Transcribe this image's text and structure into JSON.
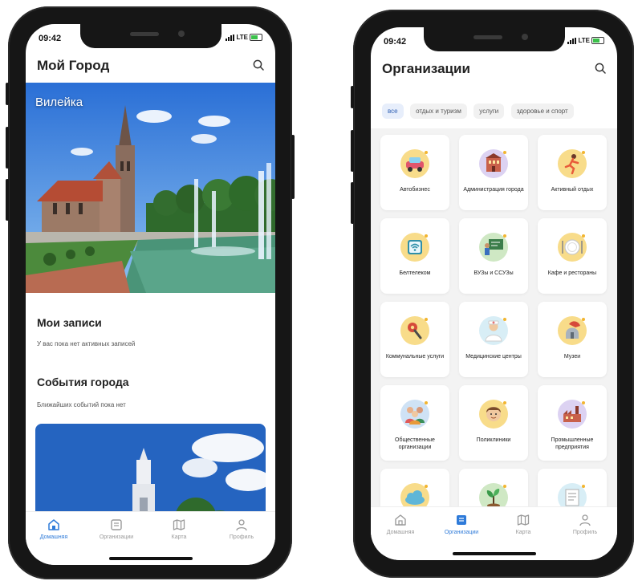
{
  "status": {
    "time": "09:42",
    "network": "LTE"
  },
  "left_screen": {
    "title": "Мой Город",
    "hero_city": "Вилейка",
    "my_records": {
      "title": "Мои записи",
      "text": "У вас пока нет активных записей"
    },
    "events": {
      "title": "События города",
      "text": "Ближайших событий пока нет"
    },
    "tabs": [
      {
        "label": "Домашняя",
        "active": true
      },
      {
        "label": "Организации",
        "active": false
      },
      {
        "label": "Карта",
        "active": false
      },
      {
        "label": "Профиль",
        "active": false
      }
    ]
  },
  "right_screen": {
    "title": "Организации",
    "chips": [
      {
        "label": "все",
        "active": true
      },
      {
        "label": "отдых и туризм",
        "active": false
      },
      {
        "label": "услуги",
        "active": false
      },
      {
        "label": "здоровье и спорт",
        "active": false
      }
    ],
    "categories": [
      {
        "label": "Автобизнес",
        "icon": "car-icon"
      },
      {
        "label": "Администрация города",
        "icon": "building-icon"
      },
      {
        "label": "Активный отдых",
        "icon": "runner-icon"
      },
      {
        "label": "Белтелеком",
        "icon": "wifi-icon"
      },
      {
        "label": "ВУЗы и ССУЗы",
        "icon": "teacher-icon"
      },
      {
        "label": "Кафе и рестораны",
        "icon": "plate-icon"
      },
      {
        "label": "Коммунальные услуги",
        "icon": "wrench-icon"
      },
      {
        "label": "Медицинские центры",
        "icon": "doctor-icon"
      },
      {
        "label": "Музеи",
        "icon": "helmet-icon"
      },
      {
        "label": "Общественные организации",
        "icon": "people-icon"
      },
      {
        "label": "Поликлиники",
        "icon": "patient-icon"
      },
      {
        "label": "Промышленные предприятия",
        "icon": "factory-icon"
      },
      {
        "label": "",
        "icon": "cloud-icon"
      },
      {
        "label": "",
        "icon": "sprout-icon"
      },
      {
        "label": "",
        "icon": "document-icon"
      }
    ],
    "tabs": [
      {
        "label": "Домашняя",
        "active": false
      },
      {
        "label": "Организации",
        "active": true
      },
      {
        "label": "Карта",
        "active": false
      },
      {
        "label": "Профиль",
        "active": false
      }
    ]
  },
  "colors": {
    "accent": "#2f7bd9",
    "icon_bg": "#f8dc8a"
  }
}
